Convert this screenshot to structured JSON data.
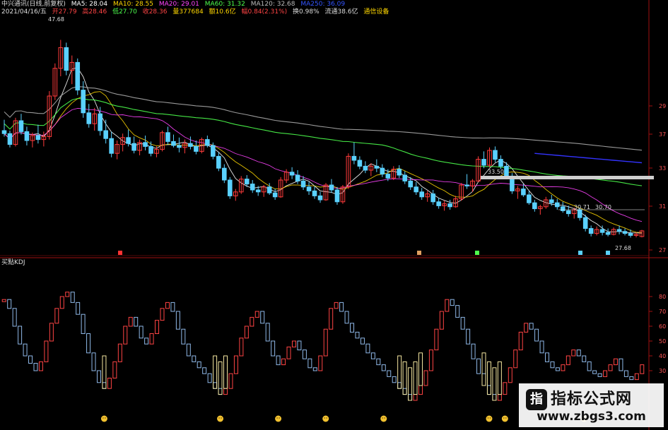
{
  "header": {
    "stock_name": "中兴通讯(日线,前复权)",
    "ma5": "MA5: 28.04",
    "ma10": "MA10: 28.55",
    "ma20": "MA20: 29.01",
    "ma60": "MA60: 31.32",
    "ma120": "MA120: 32.68",
    "ma250": "MA250: 36.09",
    "date": "2021/04/16/五",
    "open": "开27.79",
    "high": "高28.46",
    "low": "低27.70",
    "close": "收28.36",
    "volume": "量377684",
    "amount": "额10.6亿",
    "change": "幅0.84(2.31%)",
    "turnover": "换0.98%",
    "float": "流通38.6亿",
    "industry": "通信设备"
  },
  "kdj_title": "买點KDJ",
  "watermark": {
    "line1": "指标公式网",
    "line2": "www.zbgs3.com",
    "logo": "指"
  },
  "colors": {
    "up": "#ff3b3b",
    "down": "#5ad1ff",
    "ma5": "#ffffff",
    "ma10": "#ffd700",
    "ma20": "#ff44ff",
    "ma60": "#4dff4d",
    "ma120": "#aaaaaa",
    "ma250": "#3333ff",
    "k": "#e0e0e0",
    "d": "#ffd700",
    "j": "#ff00ff"
  },
  "chart_data": [
    {
      "type": "candlestick",
      "title": "中兴通讯(日线,前复权)",
      "y_ticks_right": [
        "29",
        "37",
        "33",
        "31",
        "27"
      ],
      "annotations": [
        "47.68",
        "33.50",
        "30.71",
        "30.70",
        "27.68"
      ],
      "ylim": [
        26,
        50
      ],
      "candles": [
        [
          38.5,
          39.6,
          37.9,
          38.2
        ],
        [
          38.2,
          38.5,
          36.8,
          37.1
        ],
        [
          37.1,
          39.8,
          36.9,
          39.5
        ],
        [
          39.5,
          40.2,
          38.1,
          38.4
        ],
        [
          38.4,
          38.9,
          37.0,
          37.5
        ],
        [
          37.5,
          38.3,
          36.8,
          38.0
        ],
        [
          38.0,
          39.1,
          37.2,
          37.6
        ],
        [
          37.6,
          38.4,
          36.9,
          37.9
        ],
        [
          37.9,
          42.5,
          37.6,
          42.0
        ],
        [
          42.0,
          45.3,
          41.6,
          44.8
        ],
        [
          44.8,
          47.68,
          44.0,
          46.9
        ],
        [
          46.9,
          47.4,
          44.1,
          44.6
        ],
        [
          44.6,
          46.1,
          43.2,
          45.4
        ],
        [
          45.4,
          45.8,
          42.1,
          42.6
        ],
        [
          42.6,
          43.5,
          39.8,
          40.3
        ],
        [
          40.3,
          41.2,
          38.8,
          39.2
        ],
        [
          39.2,
          40.8,
          38.5,
          40.2
        ],
        [
          40.2,
          40.9,
          38.0,
          38.5
        ],
        [
          38.5,
          39.6,
          37.2,
          37.7
        ],
        [
          37.7,
          38.4,
          35.8,
          36.2
        ],
        [
          36.2,
          37.5,
          35.6,
          37.1
        ],
        [
          37.1,
          38.2,
          36.4,
          37.8
        ],
        [
          37.8,
          38.6,
          36.9,
          37.2
        ],
        [
          37.2,
          37.9,
          36.2,
          36.5
        ],
        [
          36.5,
          37.6,
          36.0,
          37.3
        ],
        [
          37.3,
          38.0,
          36.5,
          36.9
        ],
        [
          36.9,
          37.4,
          35.9,
          36.2
        ],
        [
          36.2,
          36.9,
          35.8,
          36.6
        ],
        [
          36.6,
          38.5,
          36.4,
          38.3
        ],
        [
          38.3,
          38.9,
          37.1,
          37.4
        ],
        [
          37.4,
          38.1,
          36.8,
          37.0
        ],
        [
          37.0,
          37.8,
          36.3,
          36.8
        ],
        [
          36.8,
          37.6,
          36.2,
          37.2
        ],
        [
          37.2,
          37.9,
          36.6,
          36.9
        ],
        [
          36.9,
          37.5,
          36.1,
          36.4
        ],
        [
          36.4,
          37.8,
          36.2,
          37.6
        ],
        [
          37.6,
          38.0,
          36.8,
          37.0
        ],
        [
          37.0,
          37.3,
          35.6,
          35.9
        ],
        [
          35.9,
          36.3,
          34.4,
          34.7
        ],
        [
          34.7,
          35.1,
          33.2,
          33.5
        ],
        [
          33.5,
          33.8,
          31.6,
          31.9
        ],
        [
          31.9,
          32.6,
          31.4,
          32.3
        ],
        [
          32.3,
          33.9,
          32.1,
          33.6
        ],
        [
          33.6,
          34.0,
          32.8,
          33.1
        ],
        [
          33.1,
          33.5,
          32.2,
          32.5
        ],
        [
          32.5,
          32.9,
          31.9,
          32.3
        ],
        [
          32.3,
          33.0,
          31.8,
          32.8
        ],
        [
          32.8,
          33.2,
          32.0,
          32.2
        ],
        [
          32.2,
          32.6,
          31.5,
          31.8
        ],
        [
          31.8,
          33.8,
          31.7,
          33.5
        ],
        [
          33.5,
          34.6,
          33.2,
          34.3
        ],
        [
          34.3,
          34.8,
          33.6,
          34.0
        ],
        [
          34.0,
          34.5,
          33.1,
          33.4
        ],
        [
          33.4,
          33.9,
          32.5,
          32.8
        ],
        [
          32.8,
          33.3,
          32.0,
          32.4
        ],
        [
          32.4,
          32.9,
          31.6,
          31.9
        ],
        [
          31.9,
          32.3,
          31.2,
          31.5
        ],
        [
          31.5,
          33.2,
          31.4,
          33.0
        ],
        [
          33.0,
          33.6,
          32.2,
          32.5
        ],
        [
          32.5,
          32.8,
          31.0,
          31.3
        ],
        [
          31.3,
          33.0,
          31.1,
          32.8
        ],
        [
          32.8,
          36.2,
          32.6,
          35.9
        ],
        [
          35.9,
          37.3,
          35.1,
          35.5
        ],
        [
          35.5,
          35.9,
          34.6,
          34.9
        ],
        [
          34.9,
          35.4,
          34.2,
          34.5
        ],
        [
          34.5,
          35.2,
          33.9,
          34.9
        ],
        [
          34.9,
          35.6,
          34.3,
          34.7
        ],
        [
          34.7,
          35.1,
          33.8,
          34.1
        ],
        [
          34.1,
          34.6,
          33.4,
          33.7
        ],
        [
          33.7,
          34.9,
          33.5,
          34.6
        ],
        [
          34.6,
          35.0,
          33.7,
          34.0
        ],
        [
          34.0,
          34.4,
          33.1,
          33.4
        ],
        [
          33.4,
          33.8,
          32.5,
          32.8
        ],
        [
          32.8,
          33.3,
          32.0,
          32.3
        ],
        [
          32.3,
          32.7,
          31.5,
          31.8
        ],
        [
          31.8,
          32.4,
          31.3,
          32.1
        ],
        [
          32.1,
          32.5,
          31.0,
          31.3
        ],
        [
          31.3,
          31.7,
          30.6,
          30.9
        ],
        [
          30.9,
          31.4,
          30.4,
          31.1
        ],
        [
          31.1,
          31.5,
          30.5,
          30.8
        ],
        [
          30.8,
          31.9,
          30.7,
          31.6
        ],
        [
          31.6,
          33.2,
          31.4,
          33.0
        ],
        [
          33.0,
          34.1,
          32.6,
          32.9
        ],
        [
          32.9,
          33.6,
          32.3,
          33.4
        ],
        [
          33.4,
          35.9,
          33.3,
          35.6
        ],
        [
          35.6,
          36.4,
          34.7,
          35.0
        ],
        [
          35.0,
          36.8,
          34.8,
          36.5
        ],
        [
          36.5,
          36.9,
          35.3,
          35.6
        ],
        [
          35.6,
          36.0,
          34.6,
          34.9
        ],
        [
          34.9,
          35.3,
          33.6,
          33.9
        ],
        [
          33.9,
          34.2,
          32.1,
          32.4
        ],
        [
          32.4,
          32.9,
          31.6,
          32.6
        ],
        [
          32.6,
          33.1,
          31.8,
          32.0
        ],
        [
          32.0,
          32.4,
          31.0,
          31.2
        ],
        [
          31.2,
          31.5,
          30.3,
          30.6
        ],
        [
          30.6,
          31.0,
          30.0,
          30.8
        ],
        [
          30.8,
          31.8,
          30.6,
          31.5
        ],
        [
          31.5,
          32.0,
          30.9,
          31.2
        ],
        [
          31.2,
          31.6,
          30.5,
          30.8
        ],
        [
          30.8,
          31.3,
          30.2,
          30.4
        ],
        [
          30.4,
          30.9,
          29.8,
          30.1
        ],
        [
          30.1,
          30.71,
          29.6,
          30.5
        ],
        [
          30.5,
          30.7,
          29.4,
          29.7
        ],
        [
          29.7,
          30.0,
          28.3,
          28.6
        ],
        [
          28.6,
          28.9,
          27.8,
          28.1
        ],
        [
          28.1,
          28.8,
          27.9,
          28.5
        ],
        [
          28.5,
          28.9,
          27.9,
          28.2
        ],
        [
          28.2,
          28.6,
          27.8,
          28.0
        ],
        [
          28.0,
          28.7,
          27.9,
          28.5
        ],
        [
          28.5,
          28.9,
          28.0,
          28.3
        ],
        [
          28.3,
          28.6,
          27.9,
          28.1
        ],
        [
          28.1,
          28.5,
          27.68,
          27.9
        ],
        [
          27.9,
          28.2,
          27.7,
          28.0
        ],
        [
          27.79,
          28.46,
          27.7,
          28.36
        ]
      ]
    },
    {
      "type": "kdj",
      "title": "买點KDJ",
      "y_ticks_right": [
        "80",
        "70",
        "60",
        "50",
        "40",
        "30"
      ],
      "ylim": [
        0,
        100
      ],
      "values": [
        78,
        72,
        60,
        48,
        40,
        35,
        30,
        36,
        50,
        62,
        72,
        80,
        83,
        76,
        68,
        55,
        42,
        30,
        22,
        18,
        25,
        36,
        48,
        60,
        66,
        60,
        52,
        48,
        55,
        64,
        72,
        76,
        70,
        58,
        48,
        40,
        36,
        32,
        28,
        22,
        18,
        14,
        18,
        28,
        40,
        52,
        60,
        66,
        70,
        62,
        50,
        40,
        34,
        38,
        46,
        50,
        44,
        38,
        32,
        30,
        40,
        58,
        72,
        76,
        70,
        62,
        56,
        52,
        48,
        42,
        38,
        34,
        30,
        26,
        22,
        18,
        14,
        10,
        14,
        20,
        30,
        44,
        58,
        70,
        78,
        74,
        66,
        58,
        48,
        38,
        28,
        20,
        14,
        10,
        14,
        22,
        32,
        44,
        56,
        62,
        58,
        50,
        42,
        36,
        32,
        30,
        34,
        40,
        44,
        40,
        36,
        30,
        28,
        26,
        30,
        34,
        38,
        30,
        26,
        24,
        28,
        34
      ],
      "buy_points": [
        19,
        41,
        52,
        61,
        72,
        92,
        95,
        110
      ]
    }
  ]
}
